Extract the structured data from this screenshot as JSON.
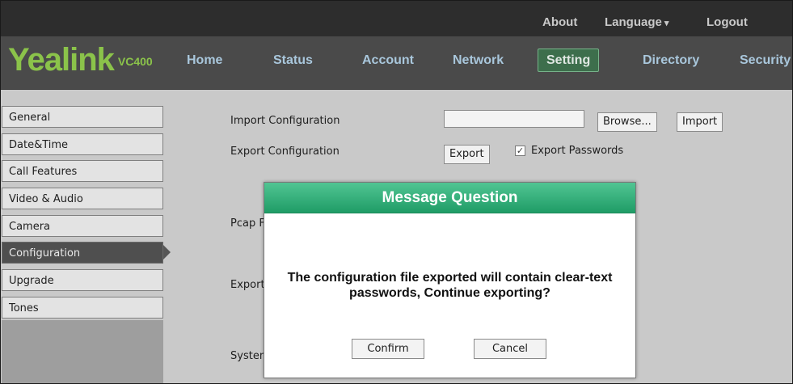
{
  "top_links": {
    "about": "About",
    "language": "Language",
    "logout": "Logout"
  },
  "logo": {
    "brand": "Yealink",
    "model": "VC400"
  },
  "nav": {
    "home": "Home",
    "status": "Status",
    "account": "Account",
    "network": "Network",
    "setting": "Setting",
    "directory": "Directory",
    "security": "Security"
  },
  "active_nav": "Setting",
  "sidebar": {
    "items": [
      {
        "label": "General"
      },
      {
        "label": "Date&Time"
      },
      {
        "label": "Call Features"
      },
      {
        "label": "Video & Audio"
      },
      {
        "label": "Camera"
      },
      {
        "label": "Configuration"
      },
      {
        "label": "Upgrade"
      },
      {
        "label": "Tones"
      }
    ],
    "active": "Configuration"
  },
  "form": {
    "import_label": "Import Configuration",
    "import_value": "",
    "browse_label": "Browse...",
    "import_button": "Import",
    "export_label": "Export Configuration",
    "export_button": "Export",
    "export_passwords_label": "Export Passwords",
    "export_passwords_checked": true,
    "pcap_label_partial": "Pcap F",
    "export_label_partial": "Export",
    "system_label_partial": "Systen"
  },
  "dialog": {
    "title": "Message Question",
    "message_line1": "The configuration file exported will contain clear-text",
    "message_line2": "passwords, Continue exporting?",
    "confirm": "Confirm",
    "cancel": "Cancel"
  },
  "colors": {
    "topbar": "#2d2d2d",
    "header": "#4a4a4a",
    "logo": "#8bc34a",
    "nav_text": "#a9c7dc",
    "active_tab": "#3d6e4c",
    "content_bg": "#c9c9c9",
    "dialog_title": "#2fb07a"
  },
  "icons": {
    "language_caret": "chevron-down-icon",
    "checkbox": "check-icon"
  }
}
